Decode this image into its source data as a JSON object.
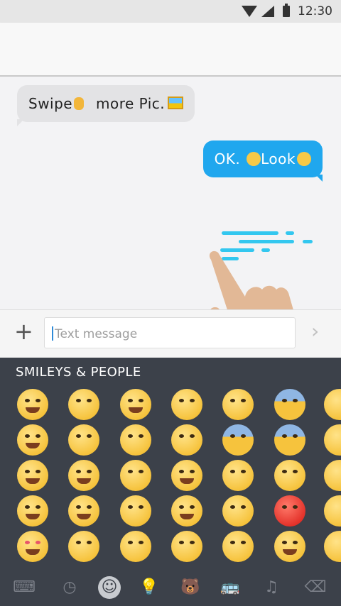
{
  "status": {
    "time": "12:30"
  },
  "messages": {
    "incoming": {
      "text": "Swipe",
      "text2": "more Pic."
    },
    "outgoing": {
      "text": "OK.",
      "text2": "Look"
    }
  },
  "composer": {
    "placeholder": "Text message"
  },
  "keyboard": {
    "category": "SMILEYS & PEOPLE",
    "tabs": [
      "keyboard-icon",
      "recent-icon",
      "smiley-icon",
      "lightbulb-icon",
      "animal-icon",
      "transport-icon",
      "symbols-icon",
      "backspace-icon"
    ]
  },
  "colors": {
    "accent": "#20a7ee",
    "keyboard_bg": "#3c414a"
  }
}
